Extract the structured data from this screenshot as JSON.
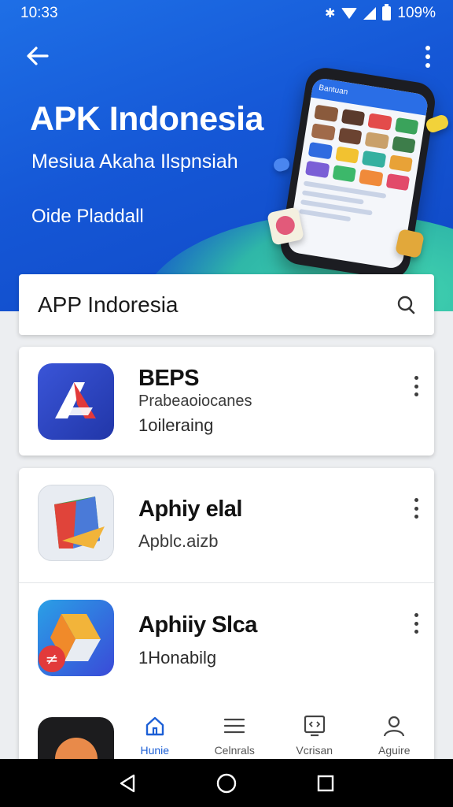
{
  "status": {
    "time": "10:33",
    "battery": "109%"
  },
  "hero": {
    "title": "APK Indonesia",
    "subtitle": "Mesiua Akaha Ilspnsiah",
    "link": "Oide Pladdall",
    "phone_header": "Bantuan"
  },
  "search": {
    "text": "APP Indoresia",
    "icon": "search-icon"
  },
  "apps": [
    {
      "name": "BEPS",
      "line1": "Prabeaoiocanes",
      "line2": "1oileraing"
    },
    {
      "name": "Aphiy elal",
      "line1": "Apblc.aizb",
      "line2": ""
    },
    {
      "name": "Aphiiy Slca",
      "line1": "",
      "line2": "1Honabilg"
    }
  ],
  "bottom_nav": [
    {
      "label": "Hunie",
      "icon": "home-icon",
      "active": true
    },
    {
      "label": "Celnrals",
      "icon": "list-icon",
      "active": false
    },
    {
      "label": "Vcrisan",
      "icon": "code-icon",
      "active": false
    },
    {
      "label": "Aguire",
      "icon": "profile-icon",
      "active": false
    }
  ],
  "colors": {
    "hero_blue": "#1557d6",
    "accent_teal": "#2fb7a8",
    "nav_active": "#1c5fd6"
  }
}
